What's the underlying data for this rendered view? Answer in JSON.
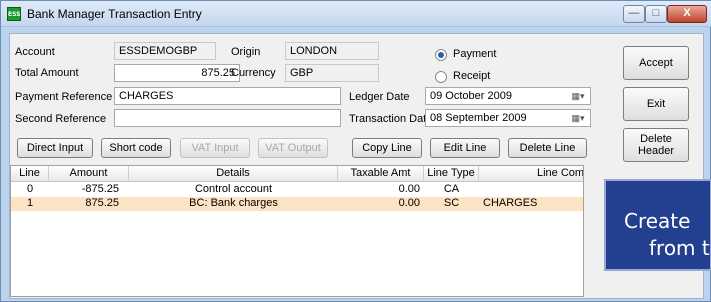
{
  "window": {
    "title": "Bank Manager Transaction Entry",
    "icon_text": "ESS",
    "controls": {
      "minimize": "—",
      "maximize": "□",
      "close": "X"
    }
  },
  "header": {
    "account_label": "Account",
    "account_value": "ESSDEMOGBP",
    "origin_label": "Origin",
    "origin_value": "LONDON",
    "total_amount_label": "Total Amount",
    "total_amount_value": "875.25",
    "currency_label": "Currency",
    "currency_value": "GBP",
    "payment_ref_label": "Payment Reference",
    "payment_ref_value": "CHARGES",
    "second_ref_label": "Second Reference",
    "second_ref_value": "",
    "ledger_date_label": "Ledger Date",
    "ledger_date_value": "09  October  2009",
    "transaction_date_label": "Transaction Date",
    "transaction_date_value": "08 September 2009",
    "type_payment_label": "Payment",
    "type_receipt_label": "Receipt",
    "selected_type": "Payment"
  },
  "toolbar": {
    "direct_input": "Direct Input",
    "short_code": "Short code",
    "vat_input": "VAT Input",
    "vat_output": "VAT Output",
    "copy_line": "Copy Line",
    "edit_line": "Edit Line",
    "delete_line": "Delete Line"
  },
  "side_buttons": {
    "accept": "Accept",
    "exit": "Exit",
    "delete_header": "Delete Header"
  },
  "grid": {
    "columns": [
      "Line",
      "Amount",
      "Details",
      "Taxable Amt",
      "Line Type",
      "Line Comm"
    ],
    "rows": [
      {
        "line": "0",
        "amount": "-875.25",
        "details": "Control account",
        "taxable": "0.00",
        "type": "CA",
        "comment": ""
      },
      {
        "line": "1",
        "amount": "875.25",
        "details": "BC: Bank charges",
        "taxable": "0.00",
        "type": "SC",
        "comment": "CHARGES"
      }
    ]
  },
  "callout": {
    "line1": "Create",
    "line2": "from t"
  }
}
